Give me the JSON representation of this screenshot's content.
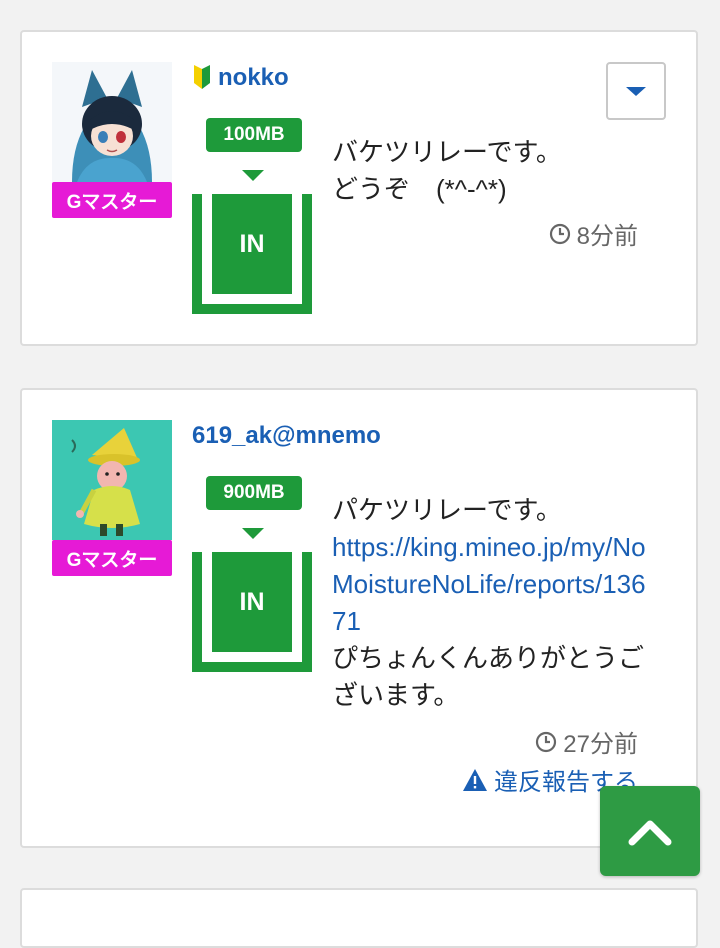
{
  "posts": [
    {
      "username": "nokko",
      "badge": "Gマスター",
      "data_amount": "100MB",
      "direction": "IN",
      "message_lines": [
        "バケツリレーです。",
        "どうぞ　(*^-^*)"
      ],
      "time": "8分前",
      "has_beginner_mark": true
    },
    {
      "username": "619_ak@mnemo",
      "badge": "Gマスター",
      "data_amount": "900MB",
      "direction": "IN",
      "message_line1": "パケツリレーです。",
      "link": "https://king.mineo.jp/my/NoMoistureNoLife/reports/13671",
      "message_line2": "ぴちょんくんありがとうございます。",
      "time": "27分前",
      "report_label": "違反報告する"
    }
  ],
  "icons": {
    "menu": "caret-down-icon",
    "clock": "clock-icon",
    "warning": "warning-icon",
    "scroll_top": "chevron-up-icon",
    "beginner": "beginner-mark-icon"
  },
  "colors": {
    "link": "#1a5fb4",
    "green": "#1e9a3a",
    "badge": "#e61ad6"
  }
}
